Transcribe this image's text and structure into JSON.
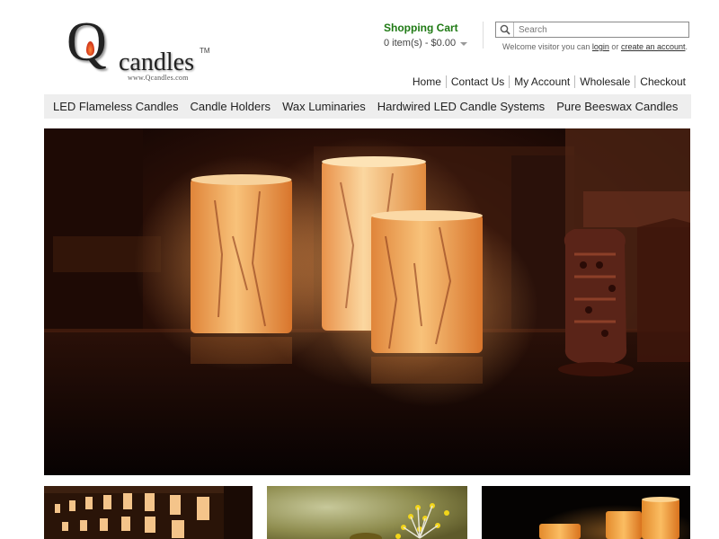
{
  "logo": {
    "letter": "Q",
    "word": "candles",
    "tm": "TM",
    "url": "www.Qcandles.com"
  },
  "cart": {
    "title": "Shopping Cart",
    "summary": "0 item(s) - $0.00"
  },
  "search": {
    "placeholder": "Search"
  },
  "welcome": {
    "prefix": "Welcome visitor you can",
    "login": "login",
    "or": "or",
    "create": "create an account",
    "suffix": "."
  },
  "toplinks": [
    "Home",
    "Contact Us",
    "My Account",
    "Wholesale",
    "Checkout"
  ],
  "nav": [
    "LED Flameless Candles",
    "Candle Holders",
    "Wax Luminaries",
    "Hardwired LED Candle Systems",
    "Pure Beeswax Candles"
  ],
  "colors": {
    "cart_title": "#1f7a14",
    "nav_bg": "#eeeeee",
    "candle_glow": "#f3a95a"
  },
  "icons": {
    "search": "magnifier-icon",
    "cart_dropdown": "caret-down-icon"
  }
}
